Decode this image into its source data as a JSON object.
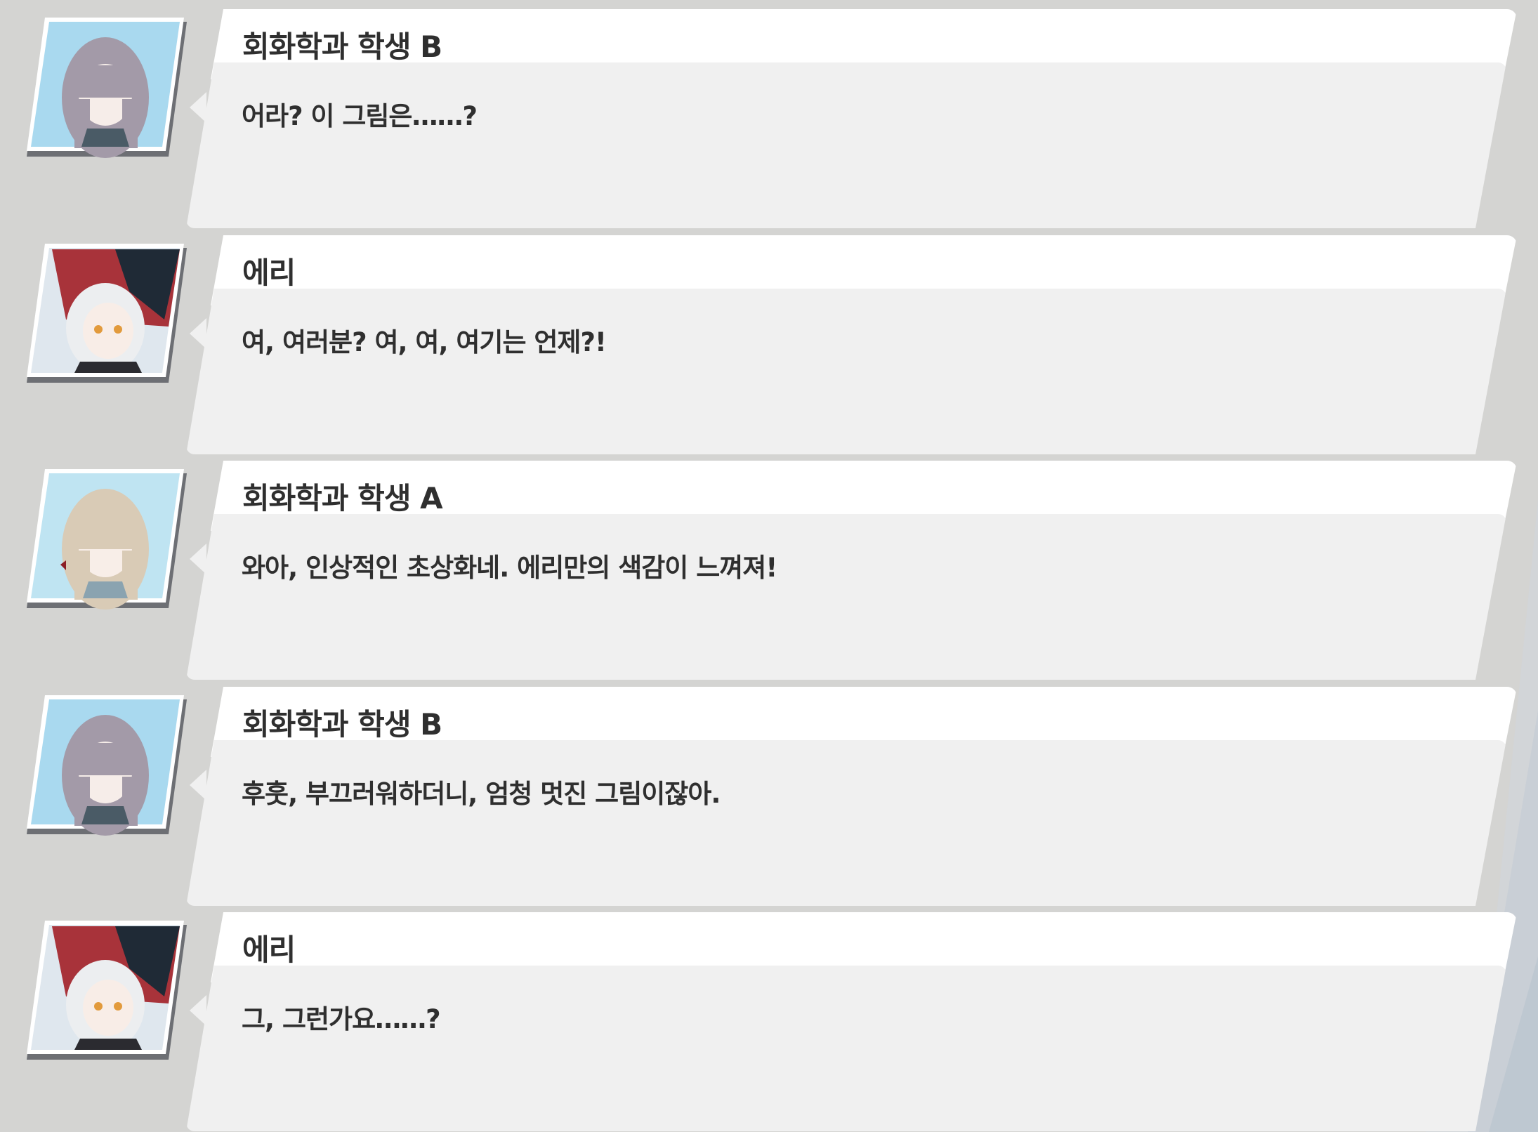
{
  "dialogue_log": [
    {
      "speaker": "회화학과 학생 B",
      "text": "어라? 이 그림은……?",
      "avatar_icon": "student-b-portrait-icon"
    },
    {
      "speaker": "에리",
      "text": "여, 여러분? 여, 여, 여기는 언제?!",
      "avatar_icon": "eri-portrait-icon"
    },
    {
      "speaker": "회화학과 학생 A",
      "text": "와아, 인상적인 초상화네. 에리만의 색감이 느껴져!",
      "avatar_icon": "student-a-portrait-icon"
    },
    {
      "speaker": "회화학과 학생 B",
      "text": "후훗, 부끄러워하더니, 엄청 멋진 그림이잖아.",
      "avatar_icon": "student-b-portrait-icon"
    },
    {
      "speaker": "에리",
      "text": "그, 그런가요……?",
      "avatar_icon": "eri-portrait-icon"
    }
  ],
  "colors": {
    "background": "#d4d4d2",
    "name_bar": "#ffffff",
    "text_box": "#f0f0f0",
    "text": "#2f2f2f"
  }
}
